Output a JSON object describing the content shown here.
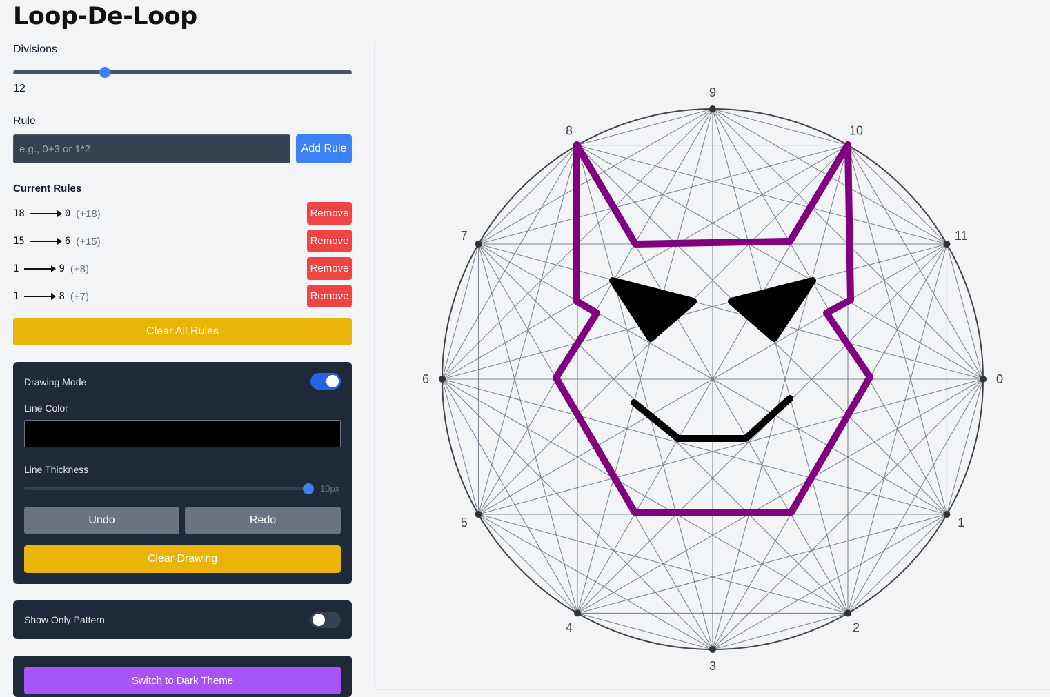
{
  "app": {
    "title": "Loop-De-Loop"
  },
  "divisions": {
    "label": "Divisions",
    "value": 12,
    "min": 2,
    "max": 40,
    "display": "12"
  },
  "rule": {
    "label": "Rule",
    "placeholder": "e.g., 0+3 or 1*2",
    "add_label": "Add Rule"
  },
  "current_rules": {
    "heading": "Current Rules",
    "remove_label": "Remove",
    "items": [
      {
        "from": "18",
        "to": "0",
        "delta": "(+18)"
      },
      {
        "from": "15",
        "to": "6",
        "delta": "(+15)"
      },
      {
        "from": "1",
        "to": "9",
        "delta": "(+8)"
      },
      {
        "from": "1",
        "to": "8",
        "delta": "(+7)"
      }
    ],
    "clear_all_label": "Clear All Rules"
  },
  "drawing": {
    "mode_label": "Drawing Mode",
    "mode_on": true,
    "color_label": "Line Color",
    "color_value": "#000000",
    "thickness_label": "Line Thickness",
    "thickness_value": "10px",
    "thickness_fraction": 1.0,
    "undo_label": "Undo",
    "redo_label": "Redo",
    "clear_label": "Clear Drawing"
  },
  "show_only_pattern": {
    "label": "Show Only Pattern",
    "on": false
  },
  "theme": {
    "button_label": "Switch to Dark Theme"
  },
  "colors": {
    "accent": "#3b82f6",
    "danger": "#ef4444",
    "warning": "#eab308",
    "panel": "#1f2937",
    "stroke_purple": "#800080",
    "stroke_black": "#000000",
    "pattern_line": "#6b7280"
  },
  "figure": {
    "point_labels": [
      "0",
      "1",
      "2",
      "3",
      "4",
      "5",
      "6",
      "7",
      "8",
      "9",
      "10",
      "11"
    ],
    "start_angle_deg": 0,
    "connections": [
      [
        0,
        1
      ],
      [
        0,
        2
      ],
      [
        0,
        3
      ],
      [
        0,
        4
      ],
      [
        0,
        5
      ],
      [
        0,
        6
      ],
      [
        0,
        7
      ],
      [
        0,
        8
      ],
      [
        0,
        9
      ],
      [
        0,
        10
      ],
      [
        0,
        11
      ],
      [
        1,
        2
      ],
      [
        1,
        3
      ],
      [
        1,
        4
      ],
      [
        1,
        5
      ],
      [
        1,
        6
      ],
      [
        1,
        7
      ],
      [
        1,
        8
      ],
      [
        1,
        9
      ],
      [
        1,
        10
      ],
      [
        1,
        11
      ],
      [
        2,
        3
      ],
      [
        2,
        4
      ],
      [
        2,
        5
      ],
      [
        2,
        6
      ],
      [
        2,
        7
      ],
      [
        2,
        8
      ],
      [
        2,
        9
      ],
      [
        2,
        10
      ],
      [
        2,
        11
      ],
      [
        3,
        4
      ],
      [
        3,
        5
      ],
      [
        3,
        6
      ],
      [
        3,
        7
      ],
      [
        3,
        8
      ],
      [
        3,
        9
      ],
      [
        3,
        10
      ],
      [
        3,
        11
      ],
      [
        4,
        5
      ],
      [
        4,
        6
      ],
      [
        4,
        7
      ],
      [
        4,
        8
      ],
      [
        4,
        9
      ],
      [
        4,
        10
      ],
      [
        4,
        11
      ],
      [
        5,
        6
      ],
      [
        5,
        7
      ],
      [
        5,
        8
      ],
      [
        5,
        9
      ],
      [
        5,
        10
      ],
      [
        5,
        11
      ],
      [
        6,
        7
      ],
      [
        6,
        8
      ],
      [
        6,
        9
      ],
      [
        6,
        10
      ],
      [
        6,
        11
      ],
      [
        7,
        8
      ],
      [
        7,
        9
      ],
      [
        7,
        10
      ],
      [
        7,
        11
      ],
      [
        8,
        9
      ],
      [
        8,
        10
      ],
      [
        8,
        11
      ],
      [
        9,
        10
      ],
      [
        9,
        11
      ],
      [
        10,
        11
      ]
    ]
  }
}
